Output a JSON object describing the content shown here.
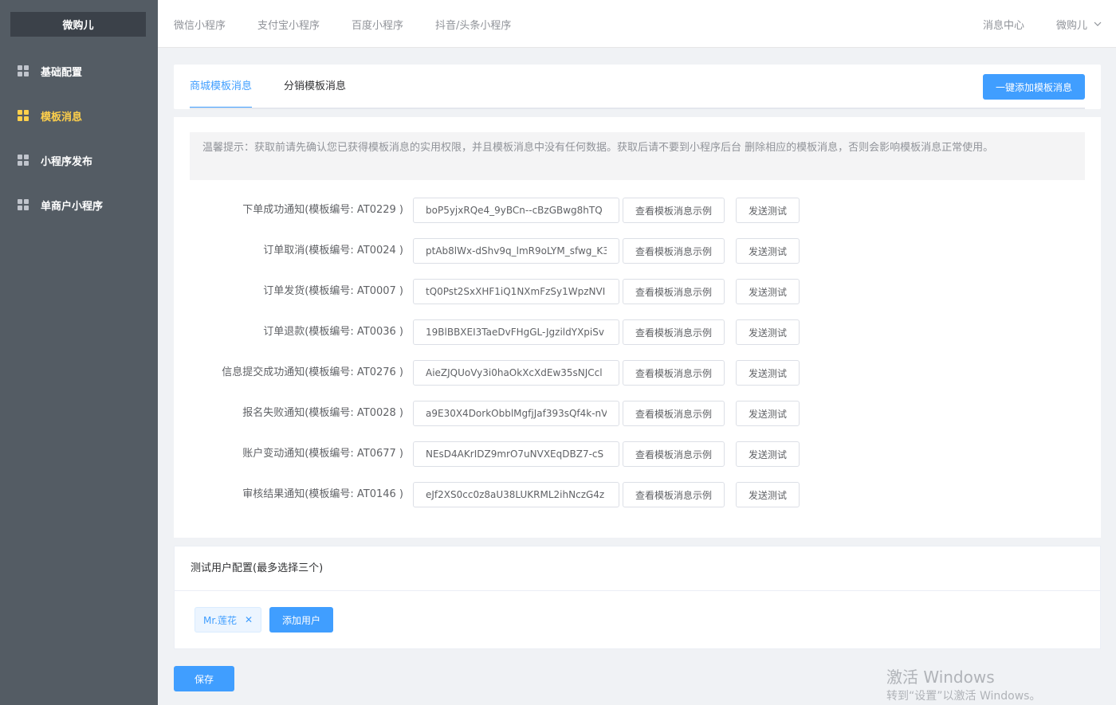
{
  "sidebar": {
    "brand": "微购儿",
    "items": [
      {
        "label": "基础配置",
        "active": false
      },
      {
        "label": "模板消息",
        "active": true
      },
      {
        "label": "小程序发布",
        "active": false
      },
      {
        "label": "单商户小程序",
        "active": false
      }
    ]
  },
  "topbar": {
    "nav": [
      "微信小程序",
      "支付宝小程序",
      "百度小程序",
      "抖音/头条小程序"
    ],
    "message_center": "消息中心",
    "user": "微购儿"
  },
  "tabs": [
    "商城模板消息",
    "分销模板消息"
  ],
  "add_all_button": "一键添加模板消息",
  "tip": "温馨提示：获取前请先确认您已获得模板消息的实用权限，并且模板消息中没有任何数据。获取后请不要到小程序后台 删除相应的模板消息，否则会影响模板消息正常使用。",
  "view_example_label": "查看模板消息示例",
  "send_test_label": "发送测试",
  "templates": [
    {
      "label": "下单成功通知(模板编号: AT0229 )",
      "value": "boP5yjxRQe4_9yBCn--cBzGBwg8hTQ"
    },
    {
      "label": "订单取消(模板编号: AT0024 )",
      "value": "ptAb8lWx-dShv9q_lmR9oLYM_sfwg_K3"
    },
    {
      "label": "订单发货(模板编号: AT0007 )",
      "value": "tQ0Pst2SxXHF1iQ1NXmFzSy1WpzNVI"
    },
    {
      "label": "订单退款(模板编号: AT0036 )",
      "value": "19BlBBXEI3TaeDvFHgGL-JgzildYXpiSv"
    },
    {
      "label": "信息提交成功通知(模板编号: AT0276 )",
      "value": "AieZJQUoVy3i0haOkXcXdEw35sNJCcl"
    },
    {
      "label": "报名失败通知(模板编号: AT0028 )",
      "value": "a9E30X4DorkObblMgfjJaf393sQf4k-nV"
    },
    {
      "label": "账户变动通知(模板编号: AT0677 )",
      "value": "NEsD4AKrIDZ9mrO7uNVXEqDBZ7-cS"
    },
    {
      "label": "审核结果通知(模板编号: AT0146 )",
      "value": "eJf2XS0cc0z8aU38LUKRML2ihNczG4z"
    }
  ],
  "test_users": {
    "title": "测试用户配置(最多选择三个)",
    "users": [
      "Mr.莲花"
    ],
    "add_button": "添加用户"
  },
  "save_button": "保存",
  "watermark": {
    "line1": "激活 Windows",
    "line2": "转到“设置”以激活 Windows。"
  },
  "colors": {
    "sidebar_bg": "#545c64",
    "active_menu": "#ffd04b",
    "primary": "#409eff"
  }
}
